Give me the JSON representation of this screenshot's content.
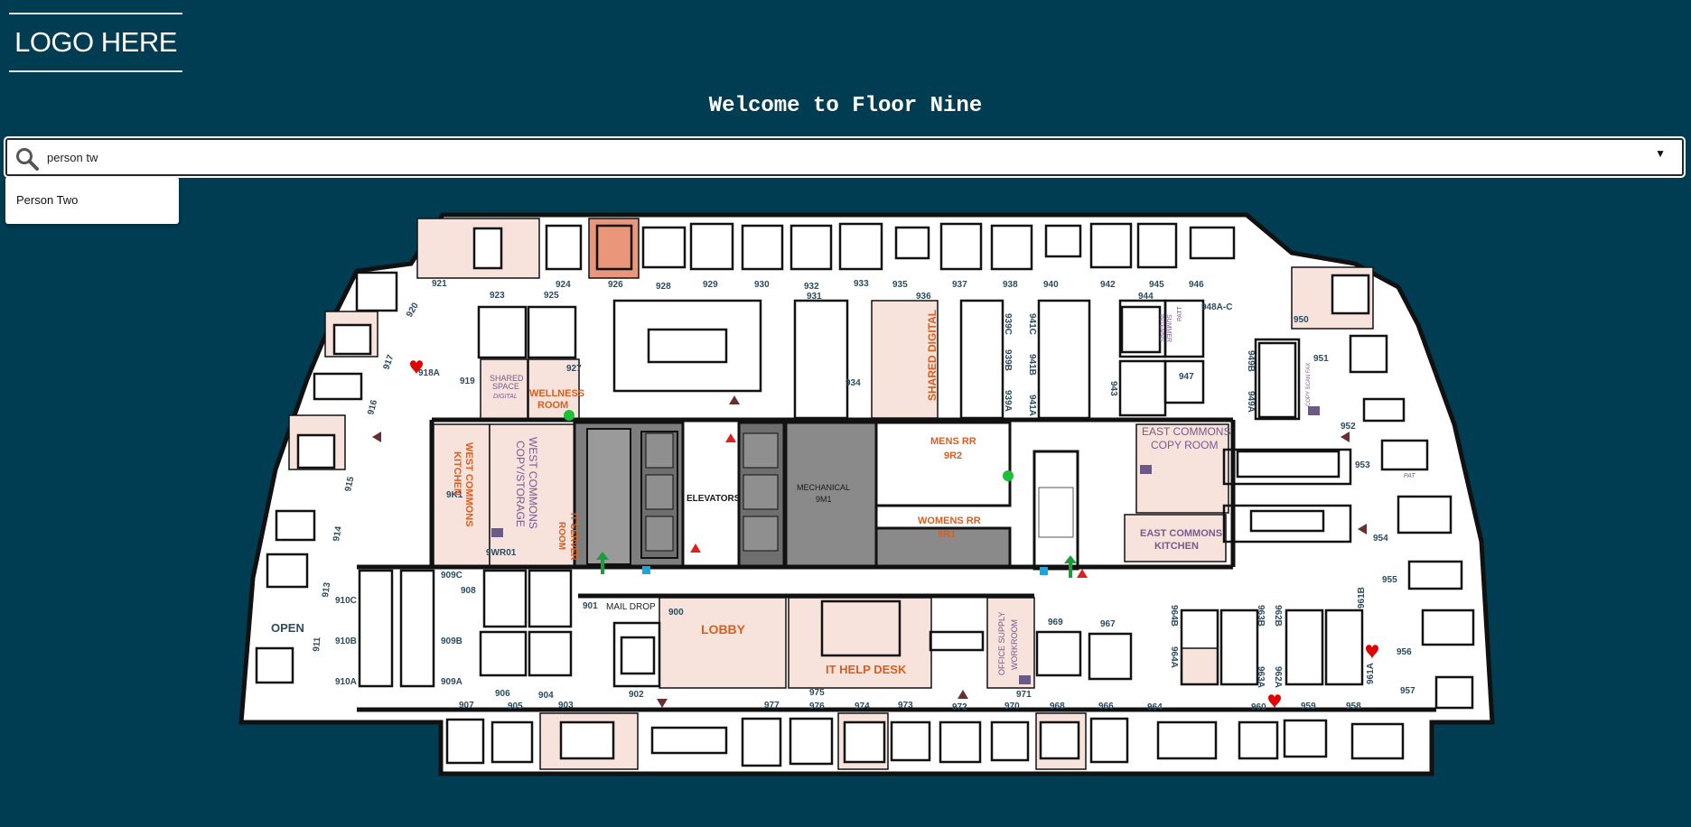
{
  "header": {
    "logo_text": "LOGO HERE",
    "title": "Welcome to Floor Nine"
  },
  "search": {
    "value": "person tw",
    "dropdown_glyph": "▼",
    "suggestions": [
      "Person Two"
    ]
  },
  "colors": {
    "background": "#003d52",
    "room_tint": "#f7e3dc",
    "highlight_room": "#e9967a",
    "core_gray": "#8a8a8a",
    "label_orange": "#d95f1f",
    "label_purple": "#7a5a8e",
    "room_number": "#2c4b5e"
  },
  "legend_icons": [
    "heart-icon",
    "exit-arrow-icon",
    "fire-extinguisher-icon",
    "first-aid-icon",
    "aed-icon",
    "printer-icon"
  ],
  "floor_plan": {
    "room_labels": {
      "r921": "921",
      "r923": "923",
      "r924": "924",
      "r925": "925",
      "r926": "926",
      "r928": "928",
      "r929": "929",
      "r930": "930",
      "r931": "931",
      "r932": "932",
      "r933": "933",
      "r935": "935",
      "r936": "936",
      "r937": "937",
      "r938": "938",
      "r940": "940",
      "r942": "942",
      "r944": "944",
      "r945": "945",
      "r946": "946",
      "r948ac": "948A-C",
      "r950": "950",
      "r951": "951",
      "r952": "952",
      "r953": "953",
      "r954": "954",
      "r955": "955",
      "r956": "956",
      "r957": "957",
      "r958": "958",
      "r959": "959",
      "r960": "960",
      "r961a": "961A",
      "r961b": "961B",
      "r962a": "962A",
      "r962b": "962B",
      "r963a": "963A",
      "r963b": "963B",
      "r964": "964",
      "r964a": "964A",
      "r964b": "964B",
      "r966": "966",
      "r967": "967",
      "r968": "968",
      "r969": "969",
      "r970": "970",
      "r971": "971",
      "r972": "972",
      "r973": "973",
      "r974": "974",
      "r975": "975",
      "r976": "976",
      "r977": "977",
      "r900": "900",
      "r901": "901",
      "r902": "902",
      "r903": "903",
      "r904": "904",
      "r905": "905",
      "r906": "906",
      "r907": "907",
      "r908": "908",
      "r909a": "909A",
      "r909b": "909B",
      "r909c": "909C",
      "r910a": "910A",
      "r910b": "910B",
      "r910c": "910C",
      "r911": "911",
      "r913": "913",
      "r914": "914",
      "r915": "915",
      "r916": "916",
      "r917": "917",
      "r918a": "918A",
      "r919": "919",
      "r920": "920",
      "r927": "927",
      "r934": "934",
      "r939a": "939A",
      "r939b": "939B",
      "r939c": "939C",
      "r941a": "941A",
      "r941b": "941B",
      "r941c": "941C",
      "r943": "943",
      "r947": "947",
      "r949a": "949A",
      "r949b": "949B",
      "r9k1": "9K1",
      "r9wr01": "9WR01",
      "r9m1": "9M1",
      "r9r1": "9R1",
      "r9r2": "9R2",
      "open": "OPEN",
      "mail_drop": "MAIL DROP",
      "elevators": "ELEVATORS",
      "mechanical": "MECHANICAL"
    },
    "named_spaces": {
      "wellness_a": "WELLNESS",
      "wellness_b": "ROOM",
      "shared_space_a": "SHARED",
      "shared_space_b": "SPACE",
      "digital": "DIGITAL",
      "west_kitchen_a": "WEST COMMONS",
      "west_kitchen_b": "KITCHEN",
      "west_copy_a": "WEST COMMONS",
      "west_copy_b": "COPY/STORAGE",
      "it_server_a": "IT SERVER",
      "it_server_b": "ROOM",
      "shared_digital": "SHARED DIGITAL",
      "mens_rr": "MENS RR",
      "womens_rr": "WOMENS RR",
      "east_copy_a": "EAST COMMONS",
      "east_copy_b": "COPY ROOM",
      "east_kitchen_a": "EAST COMMONS",
      "east_kitchen_b": "KITCHEN",
      "lobby": "LOBBY",
      "it_help": "IT HELP DESK",
      "office_supply_a": "OFFICE SUPPLY",
      "office_supply_b": "WORKROOM",
      "summer_interns_a": "SUMMER",
      "summer_interns_b": "INTERNS",
      "patt": "PATT",
      "copy_scan_fax": "COPY SCAN FAX",
      "pat": "PAT"
    }
  }
}
